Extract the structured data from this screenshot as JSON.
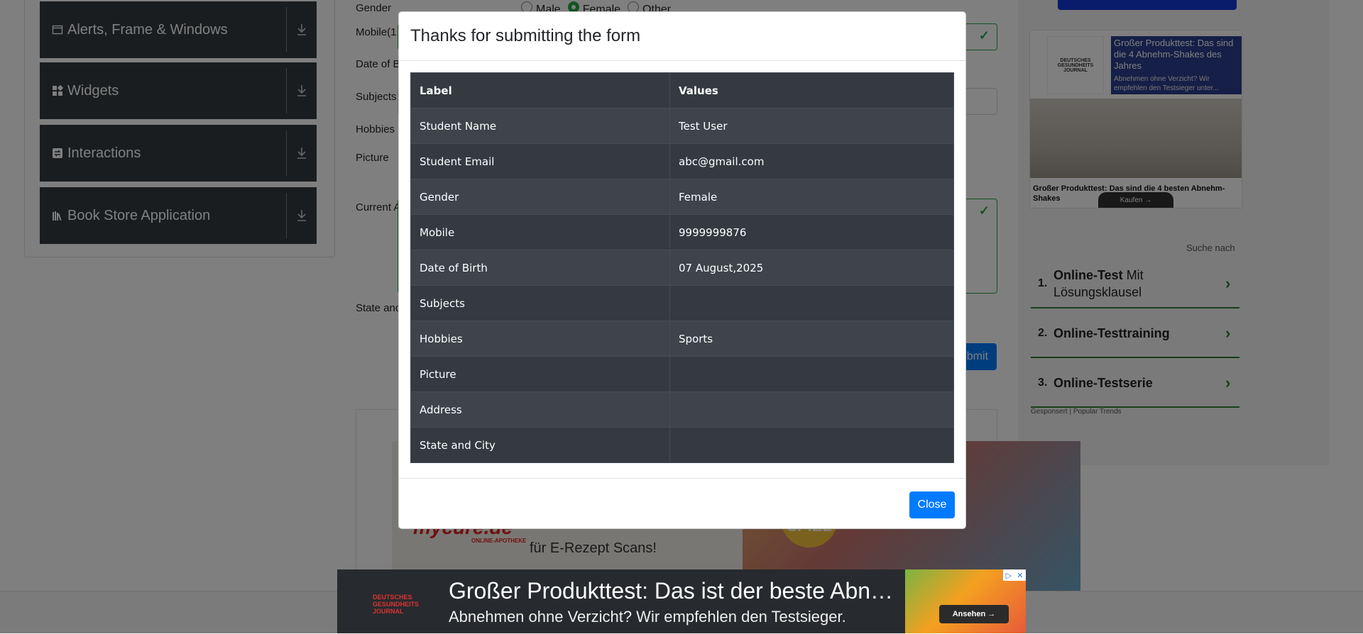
{
  "sidebar": {
    "groups": [
      {
        "label": "Alerts, Frame & Windows",
        "icon": "window-icon"
      },
      {
        "label": "Widgets",
        "icon": "widgets-icon"
      },
      {
        "label": "Interactions",
        "icon": "interactions-icon"
      },
      {
        "label": "Book Store Application",
        "icon": "books-icon"
      }
    ]
  },
  "form": {
    "labels": {
      "gender": "Gender",
      "mobile": "Mobile(1",
      "dob": "Date of B",
      "subjects": "Subjects",
      "hobbies": "Hobbies",
      "picture": "Picture",
      "address": "Current A",
      "state": "State and"
    },
    "gender_options": [
      "Male",
      "Female",
      "Other"
    ],
    "gender_selected": "Female",
    "submit_label": "bmit"
  },
  "modal": {
    "title": "Thanks for submitting the form",
    "columns": [
      "Label",
      "Values"
    ],
    "rows": [
      {
        "label": "Student Name",
        "value": "Test User"
      },
      {
        "label": "Student Email",
        "value": "abc@gmail.com"
      },
      {
        "label": "Gender",
        "value": "Female"
      },
      {
        "label": "Mobile",
        "value": "9999999876"
      },
      {
        "label": "Date of Birth",
        "value": "07 August,2025"
      },
      {
        "label": "Subjects",
        "value": ""
      },
      {
        "label": "Hobbies",
        "value": "Sports"
      },
      {
        "label": "Picture",
        "value": ""
      },
      {
        "label": "Address",
        "value": ""
      },
      {
        "label": "State and City",
        "value": ""
      }
    ],
    "close_label": "Close"
  },
  "ads": {
    "right_card": {
      "headline": "Großer Produkttest: Das sind die 4 Abnehm-Shakes des Jahres",
      "sub": "Abnehmen ohne Verzicht? Wir empfehlen den Testsieger unter...",
      "logo": "DEUTSCHES GESUNDHEITS JOURNAL",
      "caption": "Großer Produkttest: Das sind die 4 besten Abnehm-Shakes",
      "button": "Kaufen →"
    },
    "search": {
      "heading": "Suche nach",
      "items": [
        {
          "num": "1.",
          "bold": "Online-Test",
          "rest": " Mit Lösungsklausel"
        },
        {
          "num": "2.",
          "bold": "Online-Testtraining",
          "rest": ""
        },
        {
          "num": "3.",
          "bold": "Online-Testserie",
          "rest": ""
        }
      ],
      "footer": "Gesponsert | Popular Trends"
    },
    "center": {
      "brand": "mycure.de",
      "brand_sub": "ONLINE-APOTHEKE",
      "text": "für E-Rezept Scans!",
      "badge": "SPIEL"
    },
    "bottom": {
      "title": "Großer Produkttest: Das ist der beste Abnehm-Shake",
      "subtitle": "Abnehmen ohne Verzicht? Wir empfehlen den Testsieger.",
      "button": "Ansehen →"
    }
  },
  "colors": {
    "primary": "#007bff",
    "success": "#28a745",
    "table_dark": "#343a40",
    "sidebar_dark": "#353a40"
  }
}
